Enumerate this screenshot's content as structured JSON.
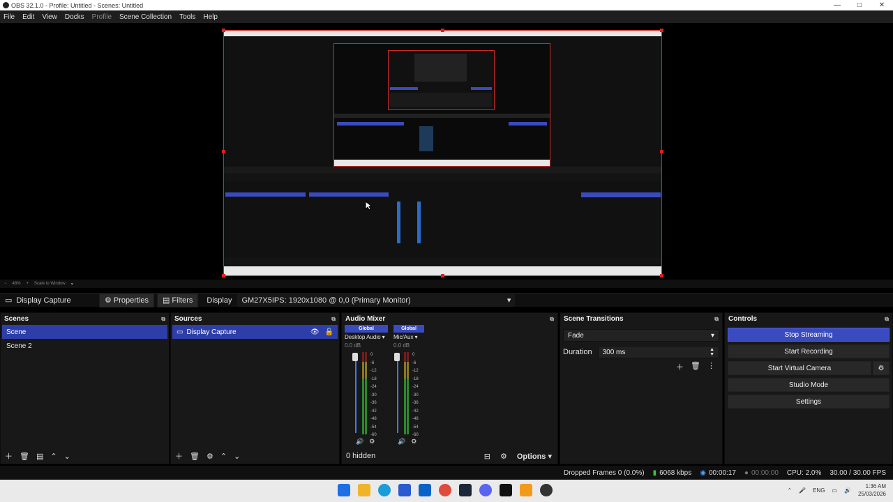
{
  "window": {
    "title": "OBS 32.1.0 - Profile: Untitled - Scenes: Untitled",
    "minimize": "—",
    "maximize": "□",
    "close": "✕"
  },
  "menu": {
    "items": [
      "File",
      "Edit",
      "View",
      "Docks",
      "Profile",
      "Scene Collection",
      "Tools",
      "Help"
    ]
  },
  "preview": {
    "zoom": "48%",
    "scale_mode": "Scale to Window"
  },
  "source_toolbar": {
    "selected_source": "Display Capture",
    "properties_label": "Properties",
    "filters_label": "Filters",
    "display_label": "Display",
    "display_value": "GM27X5IPS: 1920x1080 @ 0,0 (Primary Monitor)"
  },
  "scenes": {
    "title": "Scenes",
    "items": [
      "Scene",
      "Scene 2"
    ],
    "selected": 0
  },
  "sources": {
    "title": "Sources",
    "items": [
      "Display Capture"
    ]
  },
  "audio_mixer": {
    "title": "Audio Mixer",
    "channels": [
      {
        "tag": "Global",
        "name": "Desktop Audio",
        "db": "0.0 dB",
        "level": 0.55
      },
      {
        "tag": "Global",
        "name": "Mic/Aux",
        "db": "0.0 dB",
        "level": 0.6
      }
    ],
    "scale": [
      "0",
      "-6",
      "-12",
      "-18",
      "-24",
      "-30",
      "-36",
      "-42",
      "-48",
      "-54",
      "-60"
    ],
    "hidden_label": "0 hidden",
    "options_label": "Options"
  },
  "transitions": {
    "title": "Scene Transitions",
    "type": "Fade",
    "duration_label": "Duration",
    "duration_value": "300 ms"
  },
  "controls": {
    "title": "Controls",
    "stop_streaming": "Stop Streaming",
    "start_recording": "Start Recording",
    "start_virtual_camera": "Start Virtual Camera",
    "studio_mode": "Studio Mode",
    "settings": "Settings"
  },
  "status": {
    "dropped_frames": "Dropped Frames 0 (0.0%)",
    "bitrate": "6068 kbps",
    "stream_time": "00:00:17",
    "record_time": "00:00:00",
    "cpu": "CPU: 2.0%",
    "fps": "30.00 / 30.00 FPS"
  },
  "taskbar": {
    "lang": "ENG",
    "time": "1:36 AM",
    "date": "25/03/2026"
  },
  "colors": {
    "accent": "#3a4bc0",
    "preview_border": "#e02020",
    "panel": "#181818"
  }
}
